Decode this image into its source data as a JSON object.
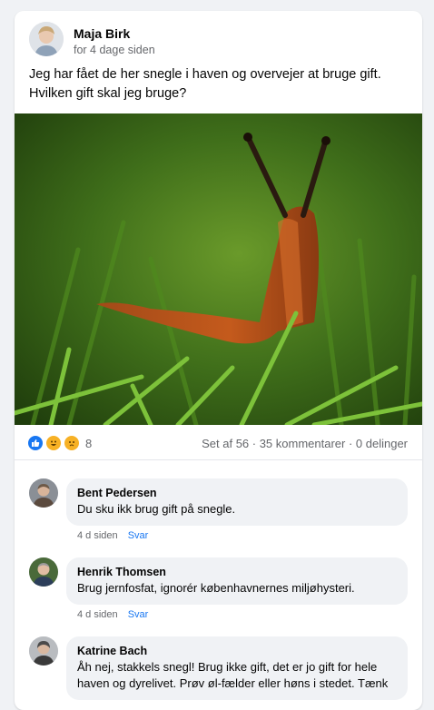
{
  "post": {
    "author": "Maja Birk",
    "time": "for 4 dage siden",
    "text": "Jeg har fået de her snegle i haven og overvejer at bruge gift. Hvilken gift skal jeg bruge?",
    "reaction_count": "8",
    "stats": "Set af 56 · 35 kommentarer · 0 delinger",
    "reaction_icons": [
      "like-icon",
      "haha-icon",
      "sad-icon"
    ]
  },
  "colors": {
    "link": "#1877f2",
    "like": "#1877f2",
    "haha": "#f7b125",
    "sad": "#f7b125",
    "meta": "#65676b"
  },
  "comments": [
    {
      "name": "Bent Pedersen",
      "text": "Du sku ikk brug gift på snegle.",
      "time": "4 d siden",
      "reply": "Svar"
    },
    {
      "name": "Henrik Thomsen",
      "text": "Brug jernfosfat, ignorér københavnernes miljøhysteri.",
      "time": "4 d siden",
      "reply": "Svar"
    },
    {
      "name": "Katrine Bach",
      "text": "Åh nej, stakkels snegl! Brug ikke gift, det er jo gift for hele haven og dyrelivet. Prøv øl-fælder eller høns i stedet. Tænk",
      "time": "",
      "reply": ""
    }
  ]
}
